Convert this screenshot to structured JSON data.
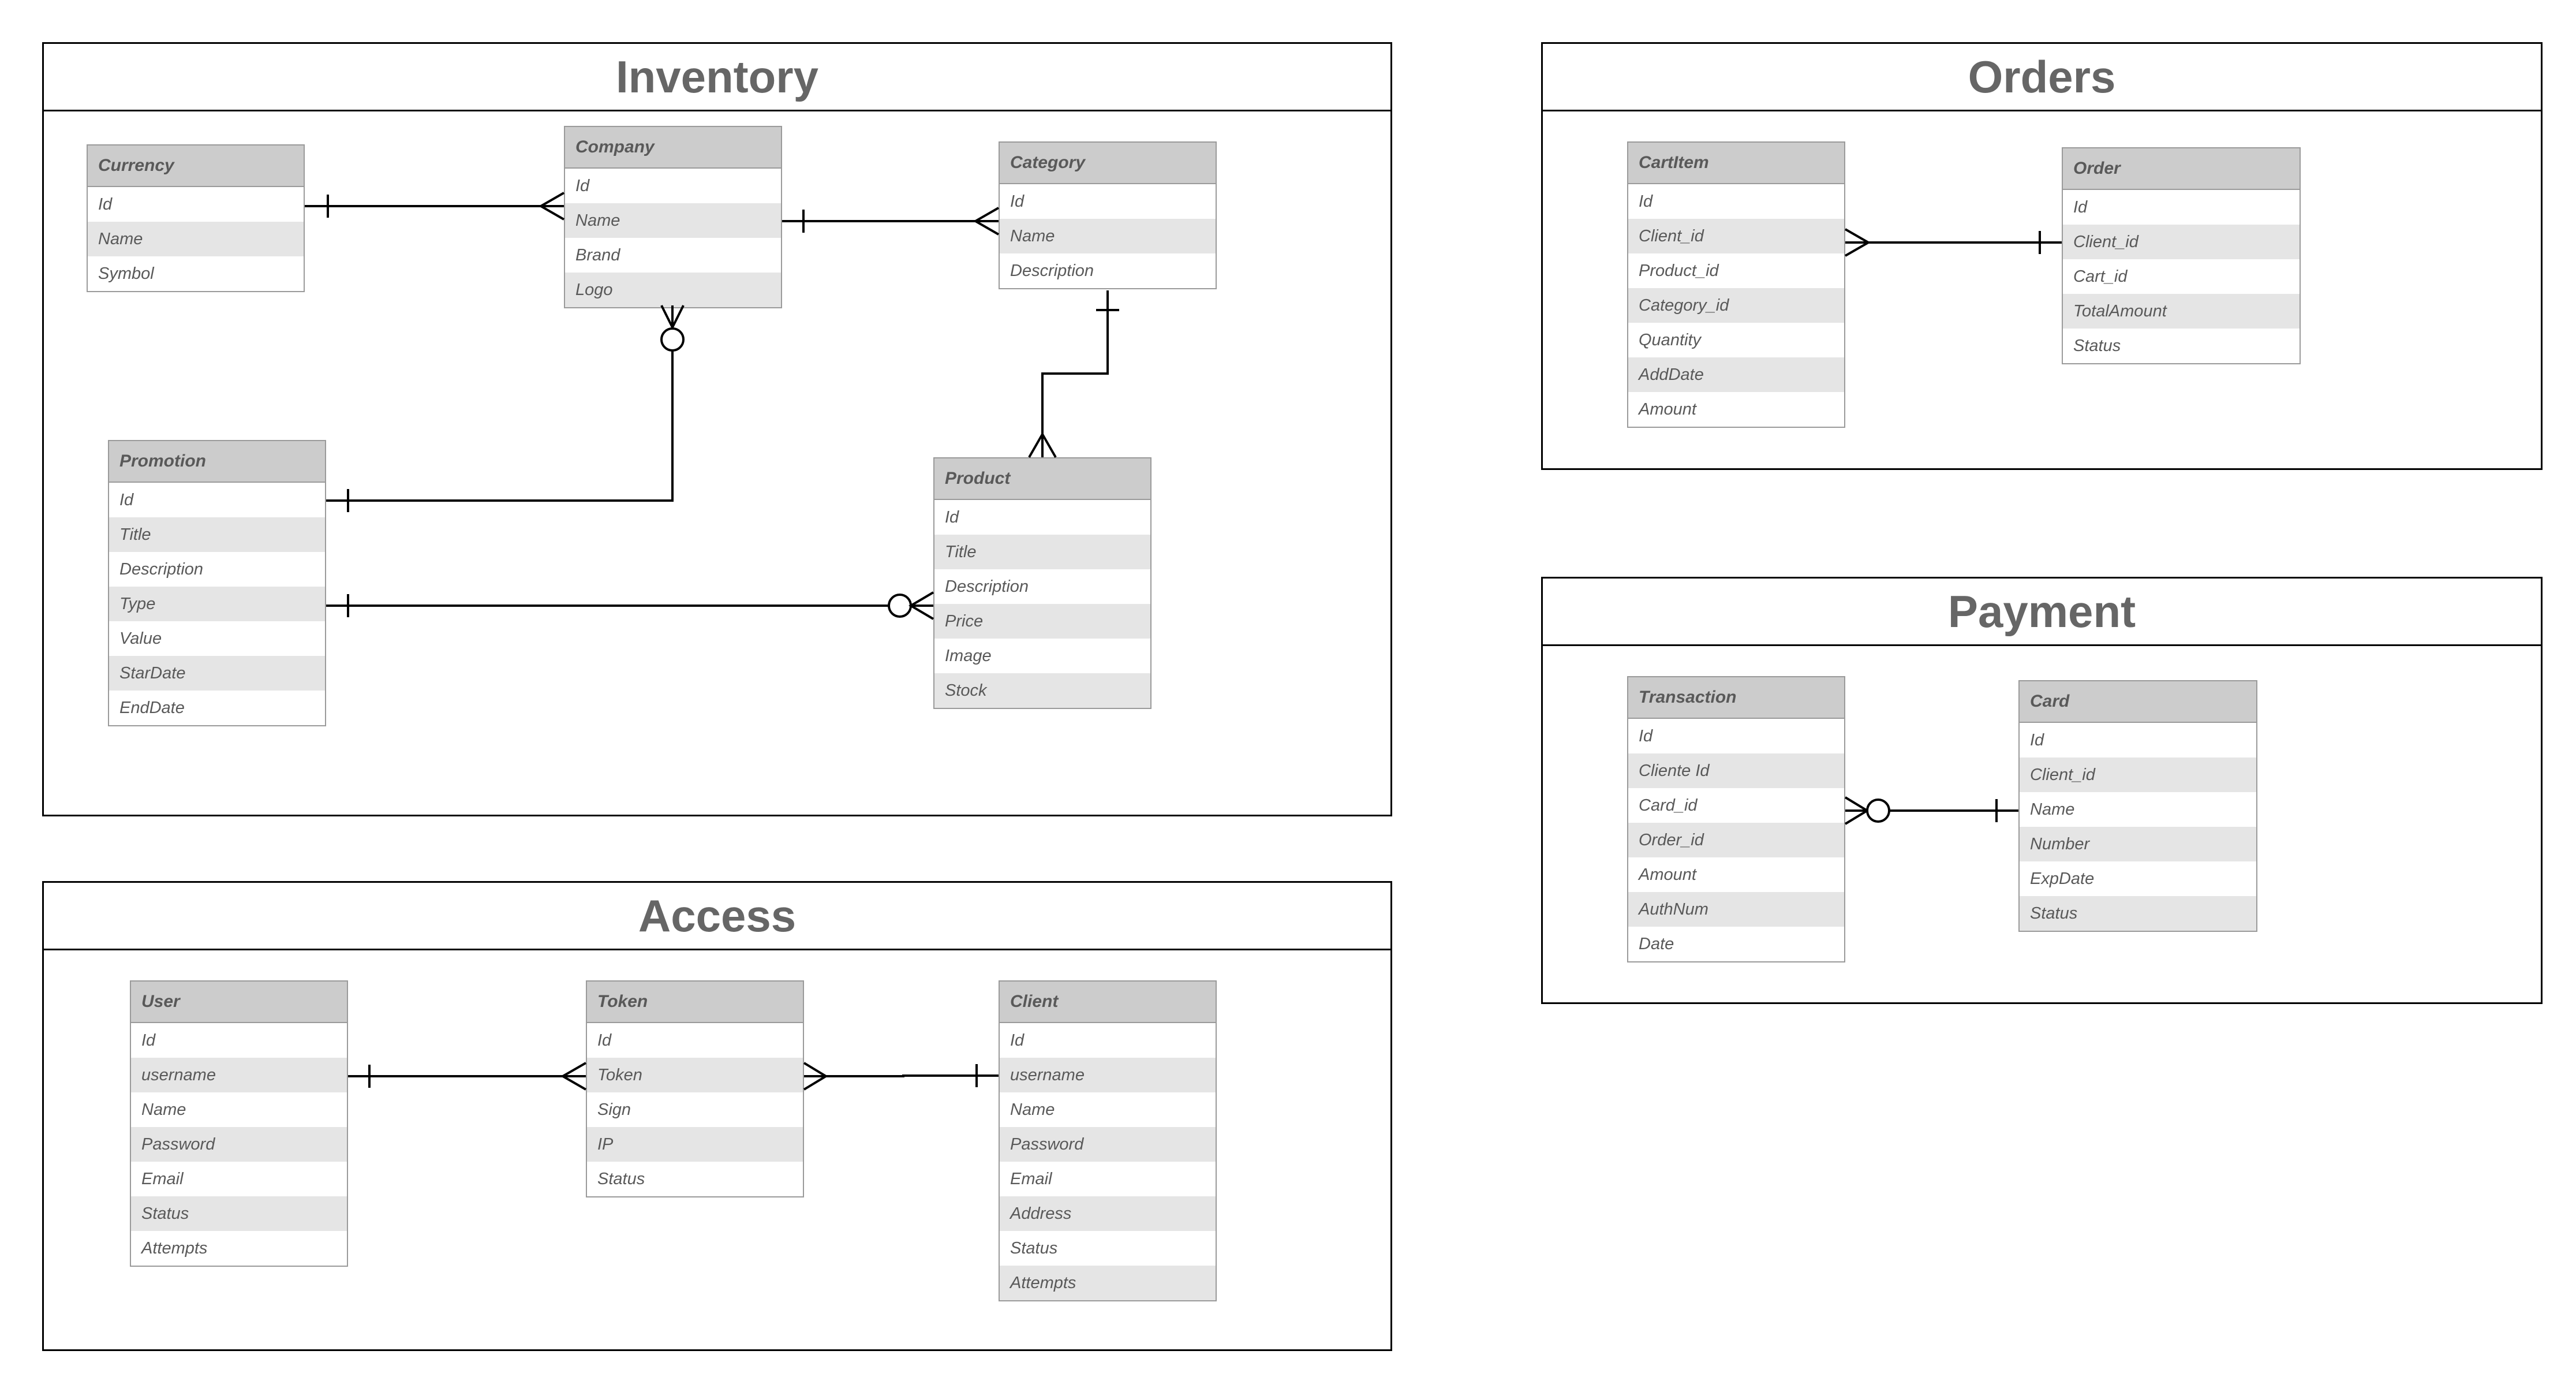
{
  "modules": {
    "inventory": "Inventory",
    "orders": "Orders",
    "payment": "Payment",
    "access": "Access"
  },
  "entities": {
    "currency": {
      "name": "Currency",
      "fields": [
        "Id",
        "Name",
        "Symbol"
      ]
    },
    "company": {
      "name": "Company",
      "fields": [
        "Id",
        "Name",
        "Brand",
        "Logo"
      ]
    },
    "category": {
      "name": "Category",
      "fields": [
        "Id",
        "Name",
        "Description"
      ]
    },
    "promotion": {
      "name": "Promotion",
      "fields": [
        "Id",
        "Title",
        "Description",
        "Type",
        "Value",
        " StarDate",
        " EndDate"
      ]
    },
    "product": {
      "name": "Product",
      "fields": [
        "Id",
        "Title",
        "Description",
        "Price",
        "Image",
        "Stock"
      ]
    },
    "cartitem": {
      "name": "CartItem",
      "fields": [
        "Id",
        "Client_id",
        "Product_id",
        "Category_id",
        "Quantity",
        "AddDate",
        "Amount"
      ]
    },
    "order": {
      "name": "Order",
      "fields": [
        "Id",
        "Client_id",
        "Cart_id",
        "TotalAmount",
        "Status"
      ]
    },
    "transaction": {
      "name": "Transaction",
      "fields": [
        "Id",
        "Cliente Id",
        "Card_id",
        "Order_id",
        "Amount",
        "AuthNum",
        "Date"
      ]
    },
    "card": {
      "name": "Card",
      "fields": [
        "Id",
        "Client_id",
        "Name",
        "Number",
        "ExpDate",
        "Status"
      ]
    },
    "user": {
      "name": "User",
      "fields": [
        "Id",
        "username",
        "Name",
        "Password",
        "Email",
        "Status",
        "Attempts"
      ]
    },
    "token": {
      "name": " Token",
      "fields": [
        "Id",
        "Token",
        "Sign",
        "IP",
        "Status"
      ]
    },
    "client": {
      "name": "Client",
      "fields": [
        "Id",
        "username",
        "Name",
        "Password",
        "Email",
        "Address",
        "Status",
        "Attempts"
      ]
    }
  }
}
